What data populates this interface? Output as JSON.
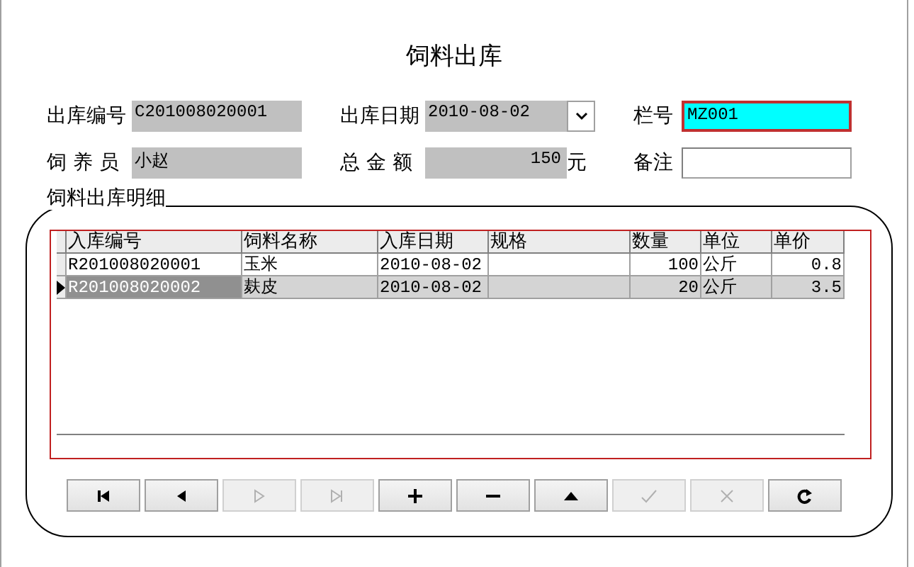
{
  "title": "饲料出库",
  "fields": [
    {
      "label": "出库编号",
      "value": "C201008020001",
      "kind": "readonly",
      "focused": false
    },
    {
      "label": "出库日期",
      "value": "2010-08-02",
      "kind": "date",
      "focused": false
    },
    {
      "label": "栏号",
      "value": "MZ001",
      "kind": "input",
      "focused": true
    },
    {
      "label": "饲 养 员",
      "value": "小赵",
      "kind": "readonly",
      "focused": false
    },
    {
      "label": "总 金 额",
      "value": "150",
      "kind": "amount",
      "unit": "元",
      "focused": false
    },
    {
      "label": "备注",
      "kind": "input",
      "focused": false
    }
  ],
  "detail": {
    "title": "饲料出库明细",
    "columns": [
      {
        "label": "入库编号",
        "kind": "text"
      },
      {
        "label": "饲料名称",
        "kind": "text"
      },
      {
        "label": "入库日期",
        "kind": "text"
      },
      {
        "label": "规格",
        "kind": "text"
      },
      {
        "label": "数量",
        "kind": "number"
      },
      {
        "label": "单位",
        "kind": "text"
      },
      {
        "label": "单价",
        "kind": "number"
      }
    ],
    "rows": [
      {
        "cells": [
          "R201008020001",
          "玉米",
          "2010-08-02",
          "",
          "100",
          "公斤",
          "0.8"
        ],
        "selected": false
      },
      {
        "cells": [
          "R201008020002",
          "麸皮",
          "2010-08-02",
          "",
          "20",
          "公斤",
          "3.5"
        ],
        "selected": true
      }
    ]
  },
  "navigator": [
    {
      "kind": "first",
      "disabled": false
    },
    {
      "kind": "prior",
      "disabled": false
    },
    {
      "kind": "next",
      "disabled": true
    },
    {
      "kind": "last",
      "disabled": true
    },
    {
      "kind": "insert",
      "disabled": false
    },
    {
      "kind": "delete",
      "disabled": false
    },
    {
      "kind": "edit",
      "disabled": false
    },
    {
      "kind": "post",
      "disabled": true
    },
    {
      "kind": "cancel",
      "disabled": true
    },
    {
      "kind": "refresh",
      "disabled": false
    }
  ]
}
